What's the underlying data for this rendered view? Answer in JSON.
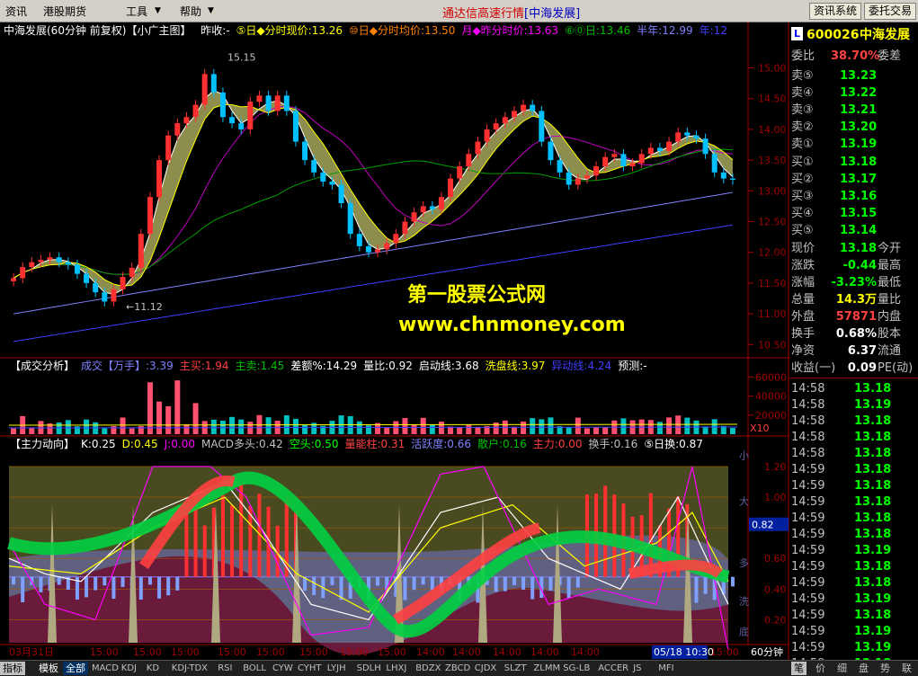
{
  "menu": {
    "items": [
      "资讯",
      "港股期货",
      "工具",
      "帮助"
    ],
    "title": "通达信高速行情",
    "broker": "[中海发展]",
    "btn_info": "资讯系统",
    "btn_trade": "委托交易"
  },
  "main_chart": {
    "title": "中海发展(60分钟 前复权)【小广主图】",
    "header_items": [
      {
        "t": "昨收:-",
        "c": "#ffffff"
      },
      {
        "t": "⑤日◆分时现价:13.26",
        "c": "#ffff00"
      },
      {
        "t": "⑩日◆分时均价:13.50",
        "c": "#ff8000"
      },
      {
        "t": "月◆昨分时价:13.63",
        "c": "#ff00ff"
      },
      {
        "t": "⑥⓪日:13.46",
        "c": "#00c000"
      },
      {
        "t": "半年:12.99",
        "c": "#8080ff"
      },
      {
        "t": "年:12",
        "c": "#4040ff"
      }
    ],
    "high_label": "15.15",
    "low_label": "←11.12",
    "y_ticks": [
      "15.00",
      "14.50",
      "14.00",
      "13.50",
      "13.00",
      "12.50",
      "12.00",
      "11.50",
      "11.00",
      "10.50"
    ]
  },
  "vol_chart": {
    "header_items": [
      {
        "t": "【成交分析】",
        "c": "#ffffff"
      },
      {
        "t": "成交【万手】:3.39",
        "c": "#8080ff"
      },
      {
        "t": "主买:1.94",
        "c": "#ff4040"
      },
      {
        "t": "主卖:1.45",
        "c": "#00c000"
      },
      {
        "t": "差额%:14.29",
        "c": "#ffffff"
      },
      {
        "t": "量比:0.92",
        "c": "#ffffff"
      },
      {
        "t": "启动线:3.68",
        "c": "#ffffff"
      },
      {
        "t": "洗盘线:3.97",
        "c": "#ffff00"
      },
      {
        "t": "异动线:4.24",
        "c": "#4040ff"
      },
      {
        "t": "预测:-",
        "c": "#ffffff"
      }
    ],
    "y_ticks": [
      "60000",
      "40000",
      "20000"
    ],
    "unit": "X10"
  },
  "ind_chart": {
    "header_items": [
      {
        "t": "【主力动向】",
        "c": "#ffffff"
      },
      {
        "t": "K:0.25",
        "c": "#ffffff"
      },
      {
        "t": "D:0.45",
        "c": "#ffff00"
      },
      {
        "t": "J:0.00",
        "c": "#ff00ff"
      },
      {
        "t": "MACD多头:0.42",
        "c": "#c0c0c0"
      },
      {
        "t": "空头:0.50",
        "c": "#00ff00"
      },
      {
        "t": "量能柱:0.31",
        "c": "#ff4040"
      },
      {
        "t": "活跃度:0.66",
        "c": "#8080ff"
      },
      {
        "t": "散户:0.16",
        "c": "#00c000"
      },
      {
        "t": "主力:0.00",
        "c": "#ff4040"
      },
      {
        "t": "换手:0.16",
        "c": "#c0c0c0"
      },
      {
        "t": "⑤日换:0.87",
        "c": "#ffffff"
      }
    ],
    "y_ticks": [
      "1.20",
      "1.00",
      "0.80",
      "0.60",
      "0.40",
      "0.20"
    ],
    "cursor_value": "0.82",
    "side_marks": [
      "小",
      "大",
      "多",
      "洗",
      "底"
    ]
  },
  "x_axis": {
    "labels": [
      "03月31日",
      "15:00",
      "15:00",
      "15:00",
      "15:00",
      "15:00",
      "15:00",
      "15:00",
      "15:00",
      "14:00",
      "14:00",
      "14:00",
      "14:00",
      "14:00",
      "15:00"
    ],
    "cursor": "05/18 10:30",
    "period": "60分钟"
  },
  "quote": {
    "code": "600026",
    "name": "中海发展",
    "weibi_label": "委比",
    "weibi": "38.70%",
    "weicha_label": "委差",
    "asks": [
      {
        "l": "卖⑤",
        "p": "13.23"
      },
      {
        "l": "卖④",
        "p": "13.22"
      },
      {
        "l": "卖③",
        "p": "13.21"
      },
      {
        "l": "卖②",
        "p": "13.20"
      },
      {
        "l": "卖①",
        "p": "13.19"
      }
    ],
    "bids": [
      {
        "l": "买①",
        "p": "13.18"
      },
      {
        "l": "买②",
        "p": "13.17"
      },
      {
        "l": "买③",
        "p": "13.16"
      },
      {
        "l": "买④",
        "p": "13.15"
      },
      {
        "l": "买⑤",
        "p": "13.14"
      }
    ],
    "stats": [
      {
        "l": "现价",
        "v": "13.18",
        "c": "#00ff00",
        "r": "今开"
      },
      {
        "l": "涨跌",
        "v": "-0.44",
        "c": "#00ff00",
        "r": "最高"
      },
      {
        "l": "涨幅",
        "v": "-3.23%",
        "c": "#00ff00",
        "r": "最低"
      },
      {
        "l": "总量",
        "v": "14.3万",
        "c": "#ffff00",
        "r": "量比"
      },
      {
        "l": "外盘",
        "v": "57871",
        "c": "#ff4040",
        "r": "内盘"
      },
      {
        "l": "换手",
        "v": "0.68%",
        "c": "#ffffff",
        "r": "股本"
      },
      {
        "l": "净资",
        "v": "6.37",
        "c": "#ffffff",
        "r": "流通"
      },
      {
        "l": "收益(一)",
        "v": "0.09",
        "c": "#ffffff",
        "r": "PE(动)"
      }
    ],
    "ticks": [
      {
        "t": "14:58",
        "p": "13.18"
      },
      {
        "t": "14:58",
        "p": "13.19"
      },
      {
        "t": "14:58",
        "p": "13.18"
      },
      {
        "t": "14:58",
        "p": "13.18"
      },
      {
        "t": "14:58",
        "p": "13.18"
      },
      {
        "t": "14:59",
        "p": "13.18"
      },
      {
        "t": "14:59",
        "p": "13.18"
      },
      {
        "t": "14:59",
        "p": "13.18"
      },
      {
        "t": "14:59",
        "p": "13.18"
      },
      {
        "t": "14:59",
        "p": "13.18"
      },
      {
        "t": "14:59",
        "p": "13.19"
      },
      {
        "t": "14:59",
        "p": "13.18"
      },
      {
        "t": "14:59",
        "p": "13.18"
      },
      {
        "t": "14:59",
        "p": "13.19"
      },
      {
        "t": "14:59",
        "p": "13.18"
      },
      {
        "t": "14:59",
        "p": "13.19"
      },
      {
        "t": "14:59",
        "p": "13.19"
      },
      {
        "t": "14:59",
        "p": "13.18"
      }
    ],
    "tabs": [
      "笔",
      "价",
      "细",
      "盘",
      "势",
      "联"
    ]
  },
  "watermark": {
    "line1": "第一股票公式网",
    "line2": "www.chnmoney.com"
  },
  "bottom": {
    "tabs": [
      "指标",
      "模板",
      "全部"
    ],
    "items": [
      "MACD",
      "KDJ",
      "KD",
      "KDJ-TDX",
      "RSI",
      "BOLL",
      "CYW",
      "CYHT",
      "LYJH",
      "SDLH",
      "LHXJ",
      "BDZX",
      "ZBCD",
      "CJDX",
      "SLZT",
      "ZLMM",
      "SG-LB",
      "ACCER",
      "JS",
      "MFI"
    ]
  },
  "chart_data": {
    "type": "candlestick",
    "ylim": [
      10.3,
      15.3
    ],
    "high": 15.15,
    "low": 11.12,
    "close_points": [
      11.58,
      11.76,
      11.84,
      11.88,
      11.92,
      11.84,
      11.8,
      11.65,
      11.5,
      11.35,
      11.2,
      11.4,
      11.6,
      11.75,
      12.3,
      12.9,
      13.5,
      13.9,
      14.1,
      14.2,
      14.4,
      14.9,
      14.6,
      14.2,
      14.1,
      14.0,
      14.45,
      14.55,
      14.3,
      14.55,
      14.3,
      13.8,
      13.5,
      13.3,
      13.15,
      13.1,
      12.8,
      12.3,
      12.1,
      12.0,
      12.05,
      12.15,
      12.3,
      12.5,
      12.65,
      12.75,
      12.7,
      12.9,
      13.2,
      13.4,
      13.6,
      13.8,
      14.0,
      14.1,
      14.2,
      14.3,
      14.4,
      14.3,
      13.8,
      13.5,
      13.3,
      13.1,
      13.2,
      13.25,
      13.4,
      13.55,
      13.6,
      13.4,
      13.45,
      13.6,
      13.7,
      13.65,
      13.8,
      13.95,
      13.9,
      13.85,
      13.6,
      13.3,
      13.2,
      13.18
    ]
  }
}
